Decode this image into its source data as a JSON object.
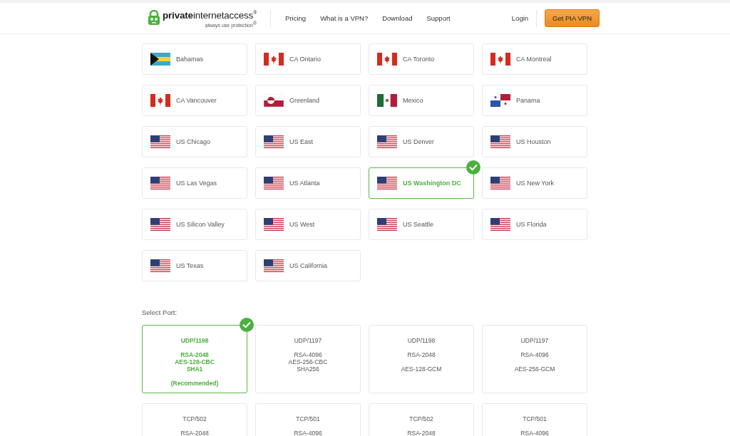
{
  "header": {
    "logo": "**private**internetaccess$^{®}$",
    "tagline": "always use protection$^{®}$",
    "nav": [
      "Pricing",
      "What is a VPN?",
      "Download",
      "Support"
    ],
    "login": "Login",
    "cta": "Get PIA VPN"
  },
  "regions": [
    {
      "name": "Bahamas",
      "kind": "bahamas",
      "selected": false
    },
    {
      "name": "CA Ontario",
      "kind": "canada",
      "selected": false
    },
    {
      "name": "CA Toronto",
      "kind": "canada",
      "selected": false
    },
    {
      "name": "CA Montreal",
      "kind": "canada",
      "selected": false
    },
    {
      "name": "CA Vancouver",
      "kind": "canada",
      "selected": false
    },
    {
      "name": "Greenland",
      "kind": "greenland",
      "selected": false
    },
    {
      "name": "Mexico",
      "kind": "mexico",
      "selected": false
    },
    {
      "name": "Panama",
      "kind": "panama",
      "selected": false
    },
    {
      "name": "US Chicago",
      "kind": "us",
      "selected": false
    },
    {
      "name": "US East",
      "kind": "us",
      "selected": false
    },
    {
      "name": "US Denver",
      "kind": "us",
      "selected": false
    },
    {
      "name": "US Houston",
      "kind": "us",
      "selected": false
    },
    {
      "name": "US Las Vegas",
      "kind": "us",
      "selected": false
    },
    {
      "name": "US Atlanta",
      "kind": "us",
      "selected": false
    },
    {
      "name": "US Washington DC",
      "kind": "us",
      "selected": true
    },
    {
      "name": "US New York",
      "kind": "us",
      "selected": false
    },
    {
      "name": "US Silicon Valley",
      "kind": "us",
      "selected": false
    },
    {
      "name": "US West",
      "kind": "us",
      "selected": false
    },
    {
      "name": "US Seattle",
      "kind": "us",
      "selected": false
    },
    {
      "name": "US Florida",
      "kind": "us",
      "selected": false
    },
    {
      "name": "US Texas",
      "kind": "us",
      "selected": false
    },
    {
      "name": "US California",
      "kind": "us",
      "selected": false
    }
  ],
  "port_heading": "Select Port:",
  "ports": [
    {
      "selected": true,
      "groups": [
        [
          "UDP/1198"
        ],
        [
          "RSA-2048",
          "AES-128-CBC",
          "SHA1"
        ],
        [
          "(Recommended)"
        ]
      ]
    },
    {
      "selected": false,
      "groups": [
        [
          "UDP/1197"
        ],
        [
          "RSA-4096",
          "AES-256-CBC",
          "SHA256"
        ]
      ]
    },
    {
      "selected": false,
      "groups": [
        [
          "UDP/1198"
        ],
        [
          "RSA-2048"
        ],
        [
          "AES-128-GCM"
        ]
      ]
    },
    {
      "selected": false,
      "groups": [
        [
          "UDP/1197"
        ],
        [
          "RSA-4096"
        ],
        [
          "AES-256-GCM"
        ]
      ]
    },
    {
      "selected": false,
      "groups": [
        [
          "TCP/502"
        ],
        [
          "RSA-2048"
        ]
      ]
    },
    {
      "selected": false,
      "groups": [
        [
          "TCP/501"
        ],
        [
          "RSA-4096"
        ]
      ]
    },
    {
      "selected": false,
      "groups": [
        [
          "TCP/502"
        ],
        [
          "RSA-2048"
        ]
      ]
    },
    {
      "selected": false,
      "groups": [
        [
          "TCP/501"
        ],
        [
          "RSA-4096"
        ]
      ]
    }
  ]
}
